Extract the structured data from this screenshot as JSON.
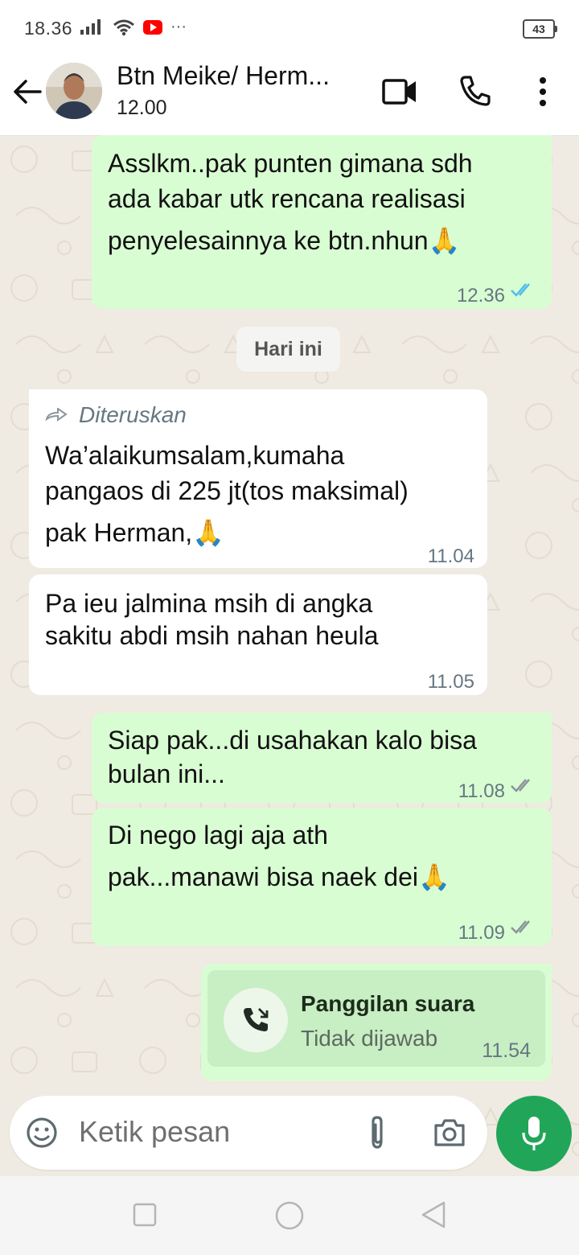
{
  "status_bar": {
    "time": "18.36",
    "battery": "43",
    "more": "···"
  },
  "header": {
    "contact_name": "Btn Meike/ Herm...",
    "status": "12.00"
  },
  "date_separator": "Hari ini",
  "messages": [
    {
      "lines": [
        "Asslkm..pak punten gimana sdh",
        "ada kabar utk rencana realisasi",
        "penyelesainnya ke btn.nhun🙏"
      ],
      "time": "12.36",
      "direction": "out",
      "ticks": "read"
    },
    {
      "forwarded_label": "Diteruskan",
      "lines": [
        "Wa’alaikumsalam,kumaha",
        "pangaos di 225 jt(tos maksimal)",
        "pak Herman,🙏"
      ],
      "time": "11.04",
      "direction": "in"
    },
    {
      "lines": [
        "Pa ieu jalmina msih di angka",
        "sakitu abdi msih nahan heula"
      ],
      "time": "11.05",
      "direction": "in"
    },
    {
      "lines": [
        "Siap pak...di usahakan  kalo bisa",
        "bulan ini..."
      ],
      "time": "11.08",
      "direction": "out",
      "ticks": "delivered"
    },
    {
      "lines": [
        "Di nego lagi aja ath",
        "pak...manawi bisa naek dei🙏"
      ],
      "time": "11.09",
      "direction": "out",
      "ticks": "delivered"
    }
  ],
  "call": {
    "title": "Panggilan suara",
    "subtitle": "Tidak dijawab",
    "time": "11.54"
  },
  "composer": {
    "placeholder": "Ketik pesan"
  },
  "colors": {
    "outgoing_bubble": "#d9fdd3",
    "incoming_bubble": "#ffffff",
    "wallpaper": "#efeae2",
    "accent_green": "#21a659",
    "read_tick_blue": "#53bdeb"
  }
}
